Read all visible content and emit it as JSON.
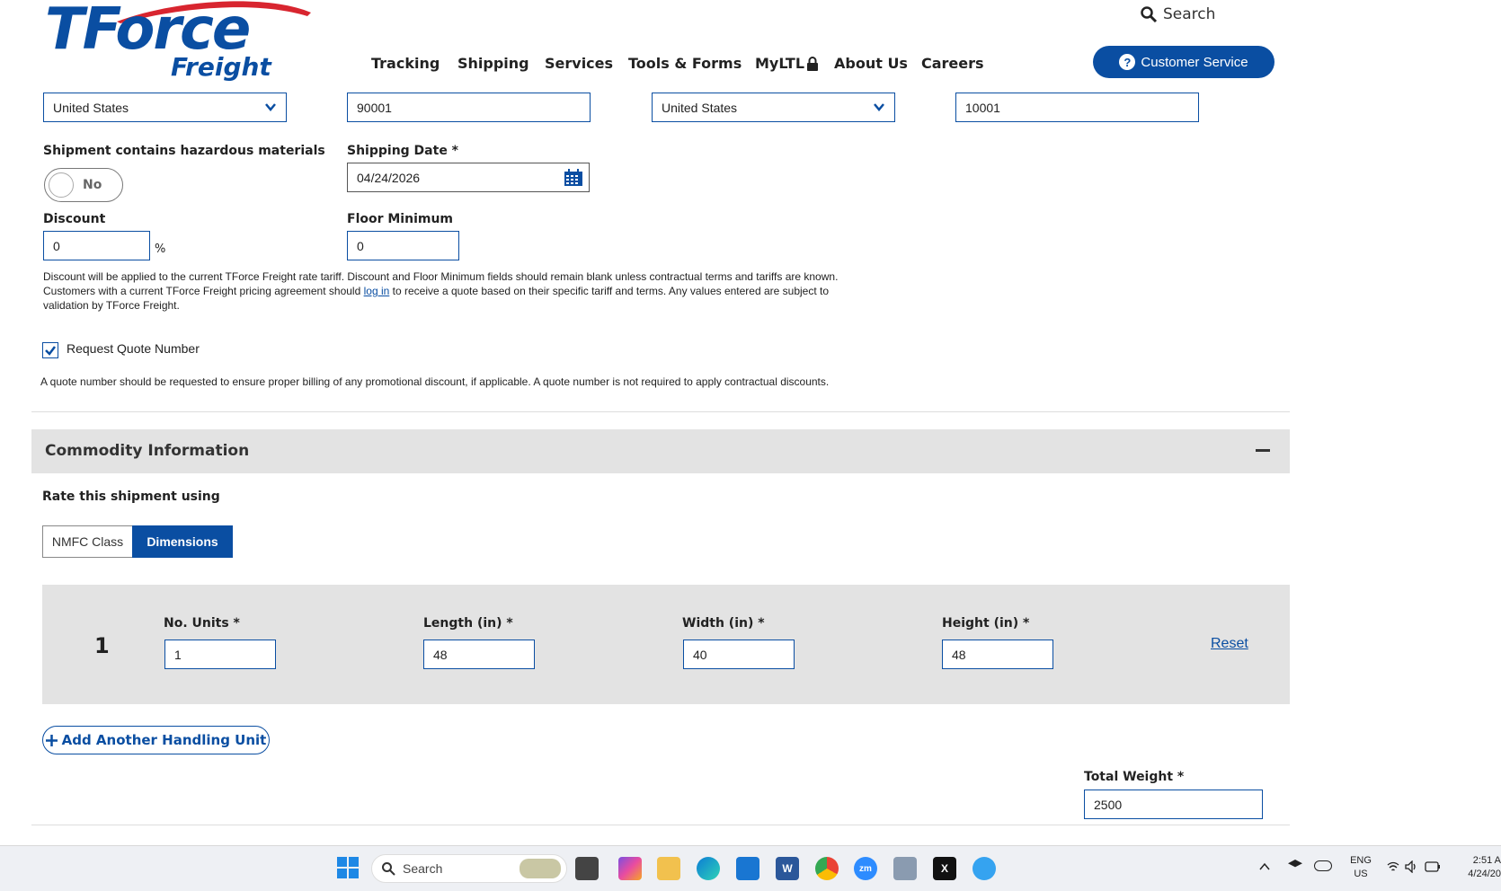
{
  "brand": {
    "name_top": "TForce",
    "name_bottom": "Freight"
  },
  "nav": {
    "items": [
      "Tracking",
      "Shipping",
      "Services",
      "Tools & Forms",
      "MyLTL",
      "About Us",
      "Careers"
    ]
  },
  "search": {
    "label": "Search"
  },
  "customer_service": {
    "label": "Customer Service"
  },
  "origin": {
    "country": "United States",
    "zip": "90001"
  },
  "destination": {
    "country": "United States",
    "zip": "10001"
  },
  "hazmat": {
    "label": "Shipment contains hazardous materials",
    "value": "No"
  },
  "shipping_date": {
    "label": "Shipping Date *",
    "value": "04/24/2026"
  },
  "discount": {
    "label": "Discount",
    "value": "0",
    "unit": "%"
  },
  "floor_minimum": {
    "label": "Floor Minimum",
    "value": "0"
  },
  "notice": {
    "line1": "Discount will be applied to the current TForce Freight rate tariff. Discount and Floor Minimum fields should remain blank unless contractual terms and tariffs are known.",
    "line2_pre": "Customers with a current TForce Freight pricing agreement should ",
    "line2_link": "log in",
    "line2_post": " to receive a quote based on their specific tariff and terms. Any values entered are subject to",
    "line3": "validation by TForce Freight."
  },
  "quote_number": {
    "label": "Request Quote Number",
    "checked": true,
    "note": "A quote number should be requested to ensure proper billing of any promotional discount, if applicable. A quote number is not required to apply contractual discounts."
  },
  "commodity": {
    "title": "Commodity Information",
    "rate_using_label": "Rate this shipment using",
    "options": [
      "NMFC Class",
      "Dimensions"
    ],
    "selected": "Dimensions",
    "unit": {
      "number": "1",
      "units_label": "No. Units *",
      "units_value": "1",
      "length_label": "Length (in) *",
      "length_value": "48",
      "width_label": "Width (in) *",
      "width_value": "40",
      "height_label": "Height (in) *",
      "height_value": "48",
      "reset_label": "Reset"
    },
    "add_unit_label": "Add Another Handling Unit",
    "total_weight_label": "Total Weight *",
    "total_weight_value": "2500"
  },
  "taskbar": {
    "search_label": "Search",
    "lang_top": "ENG",
    "lang_bottom": "US",
    "time": "2:51 A",
    "date": "4/24/20"
  },
  "colors": {
    "brand_blue": "#0a4ea2",
    "panel_gray": "#e3e3e3",
    "logo_red": "#d8252f"
  }
}
